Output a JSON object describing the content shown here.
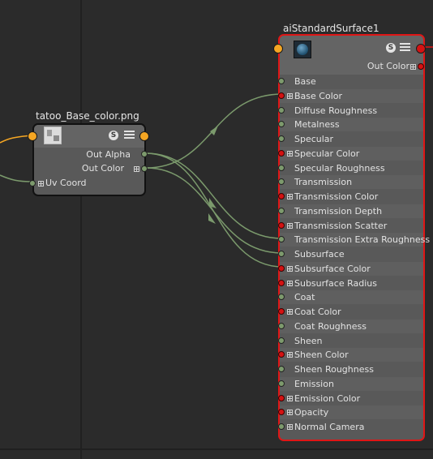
{
  "texture_node": {
    "title": "tatoo_Base_color.png",
    "swatch_label": "S",
    "outputs": [
      "Out Alpha",
      "Out Color"
    ],
    "inputs": [
      "Uv Coord"
    ]
  },
  "shader_node": {
    "title": "aiStandardSurface1",
    "swatch_label": "S",
    "output": "Out Color",
    "attributes": [
      {
        "label": "Base",
        "port": "green",
        "expandable": false
      },
      {
        "label": "Base Color",
        "port": "red",
        "expandable": true
      },
      {
        "label": "Diffuse Roughness",
        "port": "green",
        "expandable": false
      },
      {
        "label": "Metalness",
        "port": "green",
        "expandable": false
      },
      {
        "label": "Specular",
        "port": "green",
        "expandable": false
      },
      {
        "label": "Specular Color",
        "port": "red",
        "expandable": true
      },
      {
        "label": "Specular Roughness",
        "port": "green",
        "expandable": false
      },
      {
        "label": "Transmission",
        "port": "green",
        "expandable": false
      },
      {
        "label": "Transmission Color",
        "port": "red",
        "expandable": true
      },
      {
        "label": "Transmission Depth",
        "port": "green",
        "expandable": false
      },
      {
        "label": "Transmission Scatter",
        "port": "red",
        "expandable": true
      },
      {
        "label": "Transmission Extra Roughness",
        "port": "green",
        "expandable": false
      },
      {
        "label": "Subsurface",
        "port": "green",
        "expandable": false
      },
      {
        "label": "Subsurface Color",
        "port": "red",
        "expandable": true
      },
      {
        "label": "Subsurface Radius",
        "port": "red",
        "expandable": true
      },
      {
        "label": "Coat",
        "port": "green",
        "expandable": false
      },
      {
        "label": "Coat Color",
        "port": "red",
        "expandable": true
      },
      {
        "label": "Coat Roughness",
        "port": "green",
        "expandable": false
      },
      {
        "label": "Sheen",
        "port": "green",
        "expandable": false
      },
      {
        "label": "Sheen Color",
        "port": "red",
        "expandable": true
      },
      {
        "label": "Sheen Roughness",
        "port": "green",
        "expandable": false
      },
      {
        "label": "Emission",
        "port": "green",
        "expandable": false
      },
      {
        "label": "Emission Color",
        "port": "red",
        "expandable": true
      },
      {
        "label": "Opacity",
        "port": "red",
        "expandable": true
      },
      {
        "label": "Normal Camera",
        "port": "green",
        "expandable": true
      }
    ]
  },
  "colors": {
    "background": "#2b2b2b",
    "grid_line": "#202020",
    "node_body": "#595959",
    "selected_border": "#e01616",
    "connection": "#7b9a6c",
    "port_green": "#7d9a6d",
    "port_red": "#d41212",
    "port_orange": "#f5a623"
  }
}
